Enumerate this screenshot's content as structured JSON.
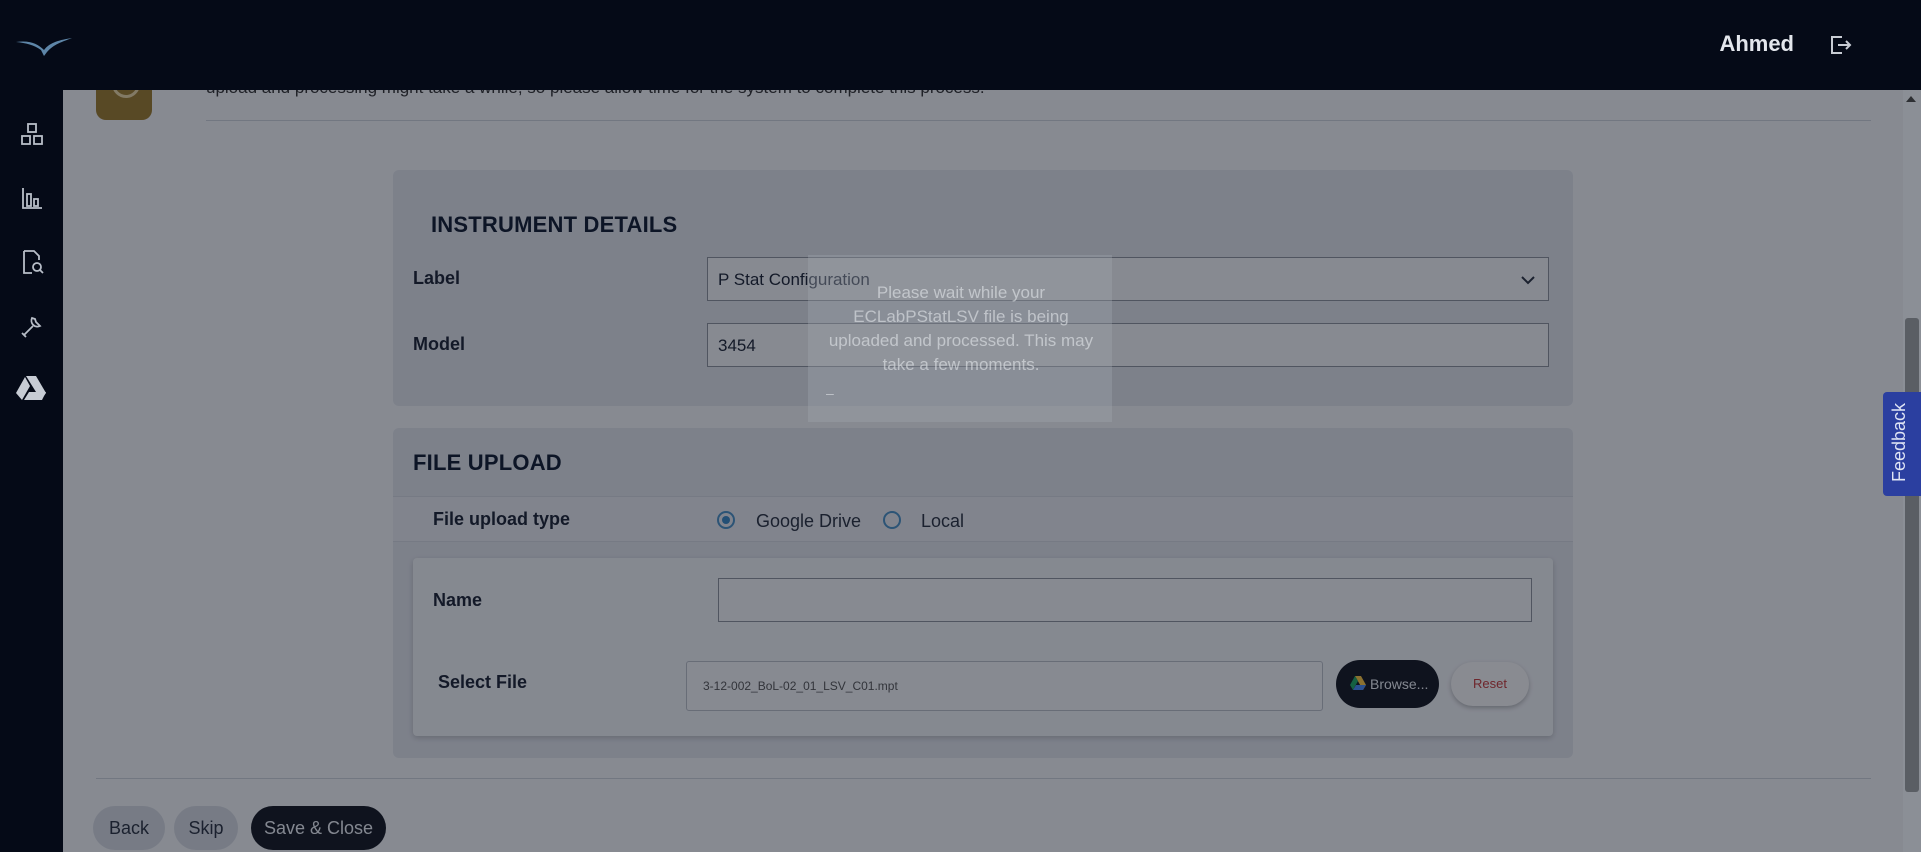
{
  "header": {
    "user_name": "Ahmed"
  },
  "sidebar": {
    "items": [
      {
        "icon": "dashboard-icon"
      },
      {
        "icon": "chart-icon"
      },
      {
        "icon": "document-search-icon"
      },
      {
        "icon": "wrench-icon"
      },
      {
        "icon": "google-drive-icon"
      }
    ]
  },
  "info": {
    "text": "upload and processing might take a while, so please allow time for the system to complete this process."
  },
  "instrument": {
    "title": "INSTRUMENT DETAILS",
    "label_label": "Label",
    "label_value": "P Stat Configuration",
    "model_label": "Model",
    "model_value": "3454"
  },
  "upload": {
    "title": "FILE UPLOAD",
    "type_label": "File upload type",
    "options": [
      "Google Drive",
      "Local"
    ],
    "selected": "Google Drive",
    "name_label": "Name",
    "name_value": "",
    "select_file_label": "Select File",
    "file_value": "3-12-002_BoL-02_01_LSV_C01.mpt",
    "browse_label": "Browse...",
    "reset_label": "Reset"
  },
  "footer": {
    "back_label": "Back",
    "skip_label": "Skip",
    "save_close_label": "Save & Close"
  },
  "modal": {
    "message": "Please wait while your ECLabPStatLSV file is being uploaded and processed. This may take a few moments.",
    "dash": "–"
  },
  "feedback_label": "Feedback",
  "colors": {
    "topbar": "#050a17",
    "primary_dark": "#141922",
    "radio_accent": "#3a86c0",
    "reset_text": "#c23b3b",
    "feedback_bg": "#2b3fa0"
  }
}
